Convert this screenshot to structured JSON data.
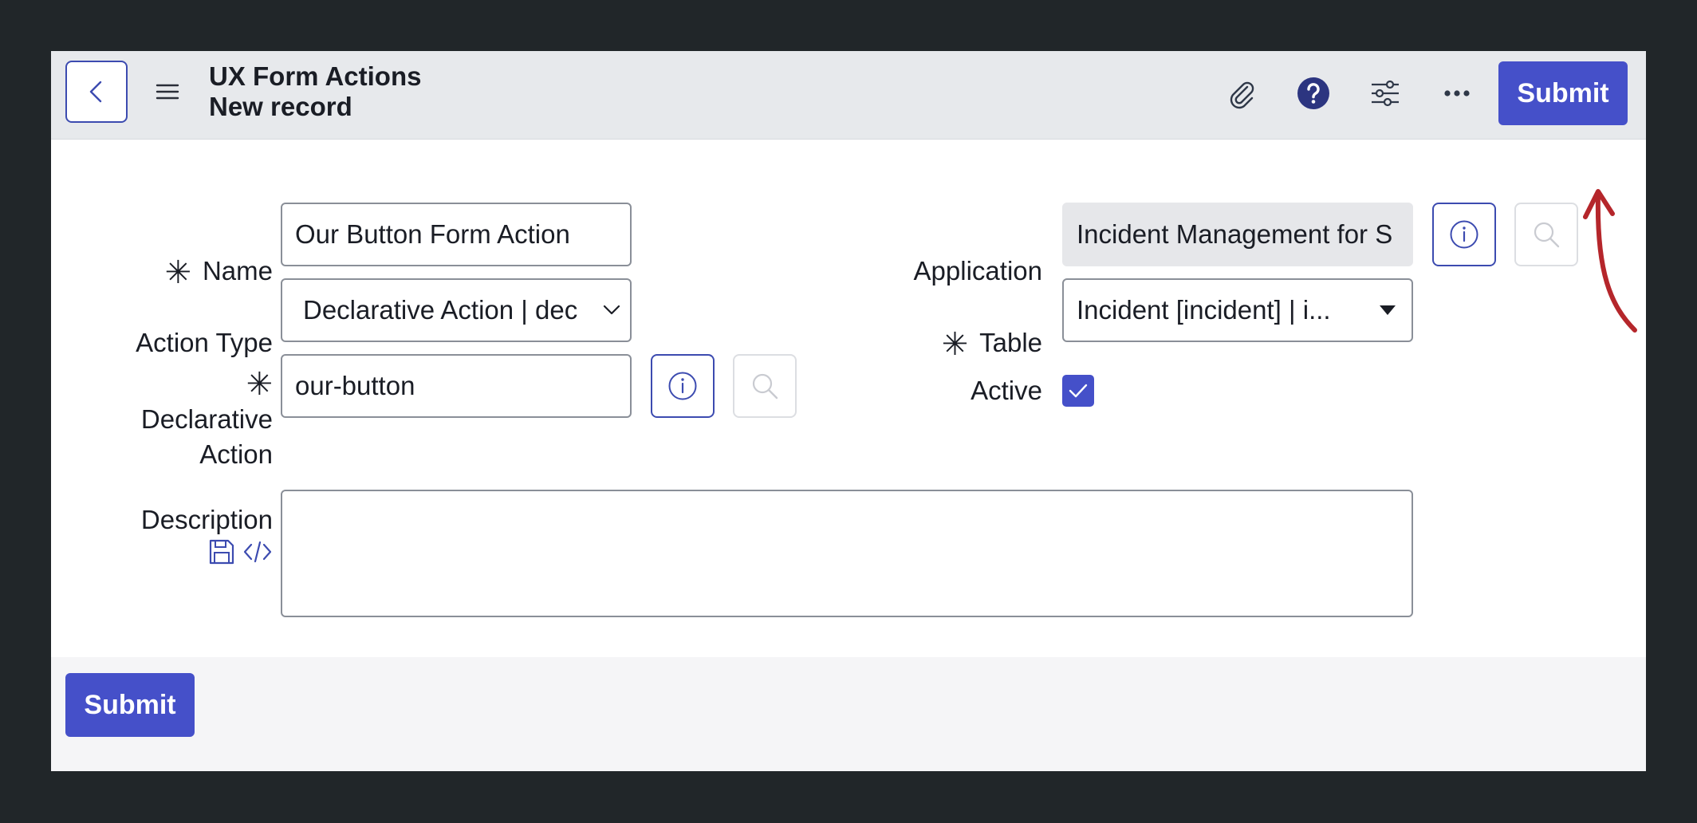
{
  "header": {
    "title": "UX Form Actions",
    "subtitle": "New record",
    "back_icon": "chevron-left-icon",
    "menu_icon": "hamburger-icon",
    "attachment_icon": "paperclip-icon",
    "help_icon": "help-icon",
    "settings_icon": "sliders-icon",
    "more_icon": "more-horizontal-icon",
    "submit_label": "Submit"
  },
  "form": {
    "name": {
      "label": "Name",
      "required_mark": "✳",
      "value": "Our Button Form Action"
    },
    "action_type": {
      "label": "Action Type",
      "value": "Declarative Action | dec"
    },
    "declarative_action": {
      "label_line1": "Declarative",
      "label_line2": "Action",
      "required_mark": "✳",
      "value": "our-button"
    },
    "description": {
      "label": "Description",
      "value": ""
    },
    "application": {
      "label": "Application",
      "value": "Incident Management for S"
    },
    "table": {
      "label": "Table",
      "required_mark": "✳",
      "value": "Incident [incident] | i..."
    },
    "active": {
      "label": "Active",
      "checked": true
    }
  },
  "footer": {
    "submit_label": "Submit"
  },
  "colors": {
    "primary": "#4550c9",
    "annotation_arrow": "#b5262b",
    "header_bg": "#e7e9ec",
    "outer_bg": "#212629"
  }
}
